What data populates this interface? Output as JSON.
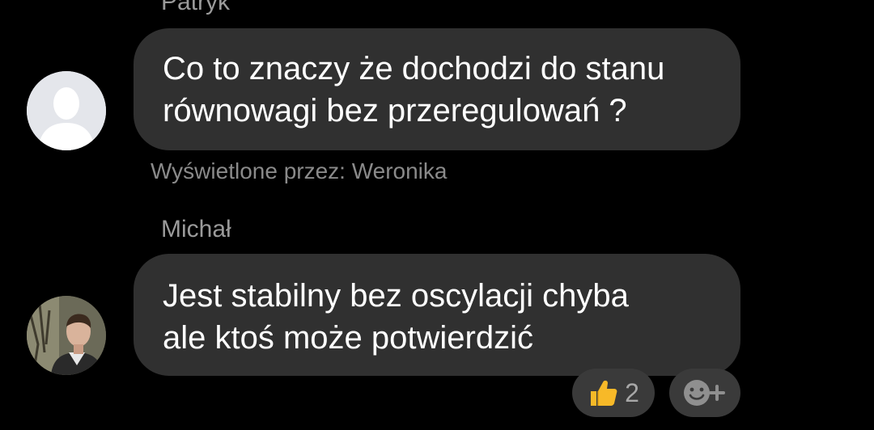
{
  "messages": [
    {
      "sender": "Patryk",
      "lines": [
        "Co to znaczy że dochodzi do stanu",
        "równowagi bez przeregulowań ?"
      ],
      "seen_by": "Wyświetlone przez: Weronika"
    },
    {
      "sender": "Michał",
      "lines": [
        "Jest stabilny bez oscylacji chyba",
        "ale ktoś może potwierdzić"
      ],
      "reactions": {
        "emoji_icon": "thumbs-up-icon",
        "count": "2"
      },
      "add_reaction_icon": "add-reaction-icon"
    }
  ],
  "colors": {
    "background": "#000000",
    "bubble": "#303030",
    "meta_text": "#9a9a9a",
    "thumbs_up": "#f7b928"
  }
}
